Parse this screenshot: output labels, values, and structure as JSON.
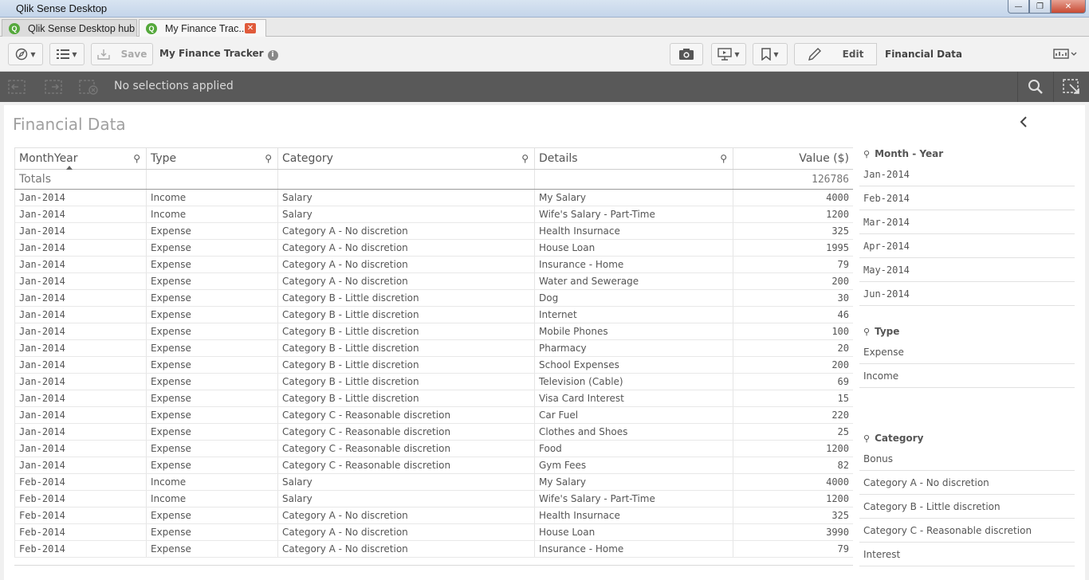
{
  "window": {
    "title": "Qlik Sense Desktop"
  },
  "tabs": [
    {
      "label": "Qlik Sense Desktop hub"
    },
    {
      "label": "My Finance Trac..."
    }
  ],
  "toolbar": {
    "save_label": "Save",
    "app_title": "My Finance Tracker",
    "edit_label": "Edit",
    "sheet_name": "Financial Data"
  },
  "selections": {
    "status": "No selections applied"
  },
  "sheet": {
    "title": "Financial Data"
  },
  "table": {
    "columns": [
      "MonthYear",
      "Type",
      "Category",
      "Details",
      "Value ($)"
    ],
    "totals_label": "Totals",
    "totals_value": "126786",
    "rows": [
      [
        "Jan-2014",
        "Income",
        "Salary",
        "My Salary",
        "4000"
      ],
      [
        "Jan-2014",
        "Income",
        "Salary",
        "Wife's Salary - Part-Time",
        "1200"
      ],
      [
        "Jan-2014",
        "Expense",
        "Category A - No discretion",
        "Health Insurnace",
        "325"
      ],
      [
        "Jan-2014",
        "Expense",
        "Category A - No discretion",
        "House Loan",
        "1995"
      ],
      [
        "Jan-2014",
        "Expense",
        "Category A - No discretion",
        "Insurance - Home",
        "79"
      ],
      [
        "Jan-2014",
        "Expense",
        "Category A - No discretion",
        "Water and Sewerage",
        "200"
      ],
      [
        "Jan-2014",
        "Expense",
        "Category B - Little discretion",
        "Dog",
        "30"
      ],
      [
        "Jan-2014",
        "Expense",
        "Category B - Little discretion",
        "Internet",
        "46"
      ],
      [
        "Jan-2014",
        "Expense",
        "Category B - Little discretion",
        "Mobile Phones",
        "100"
      ],
      [
        "Jan-2014",
        "Expense",
        "Category B - Little discretion",
        "Pharmacy",
        "20"
      ],
      [
        "Jan-2014",
        "Expense",
        "Category B - Little discretion",
        "School Expenses",
        "200"
      ],
      [
        "Jan-2014",
        "Expense",
        "Category B - Little discretion",
        "Television (Cable)",
        "69"
      ],
      [
        "Jan-2014",
        "Expense",
        "Category B - Little discretion",
        "Visa Card Interest",
        "15"
      ],
      [
        "Jan-2014",
        "Expense",
        "Category C - Reasonable discretion",
        "Car Fuel",
        "220"
      ],
      [
        "Jan-2014",
        "Expense",
        "Category C - Reasonable discretion",
        "Clothes and Shoes",
        "25"
      ],
      [
        "Jan-2014",
        "Expense",
        "Category C - Reasonable discretion",
        "Food",
        "1200"
      ],
      [
        "Jan-2014",
        "Expense",
        "Category C - Reasonable discretion",
        "Gym Fees",
        "82"
      ],
      [
        "Feb-2014",
        "Income",
        "Salary",
        "My Salary",
        "4000"
      ],
      [
        "Feb-2014",
        "Income",
        "Salary",
        "Wife's Salary - Part-Time",
        "1200"
      ],
      [
        "Feb-2014",
        "Expense",
        "Category A - No discretion",
        "Health Insurnace",
        "325"
      ],
      [
        "Feb-2014",
        "Expense",
        "Category A - No discretion",
        "House Loan",
        "3990"
      ],
      [
        "Feb-2014",
        "Expense",
        "Category A - No discretion",
        "Insurance - Home",
        "79"
      ]
    ]
  },
  "filters": {
    "month_year": {
      "title": "Month - Year",
      "items": [
        "Jan-2014",
        "Feb-2014",
        "Mar-2014",
        "Apr-2014",
        "May-2014",
        "Jun-2014"
      ]
    },
    "type": {
      "title": "Type",
      "items": [
        "Expense",
        "Income"
      ]
    },
    "category": {
      "title": "Category",
      "items": [
        "Bonus",
        "Category A - No discretion",
        "Category B - Little discretion",
        "Category C - Reasonable discretion",
        "Interest"
      ]
    }
  },
  "colors": {
    "selection_bar": "#595959",
    "sheet_bg": "#ffffff",
    "accent_green": "#54a83b",
    "close_red": "#e05a3a"
  },
  "icons": {
    "navigation": "compass-icon",
    "app_overview": "list-icon",
    "snapshot": "camera-icon",
    "story": "presentation-icon",
    "bookmark": "bookmark-icon",
    "edit": "pencil-icon",
    "sheets": "sheets-icon",
    "search": "search-icon",
    "lasso": "selection-tool-icon"
  }
}
